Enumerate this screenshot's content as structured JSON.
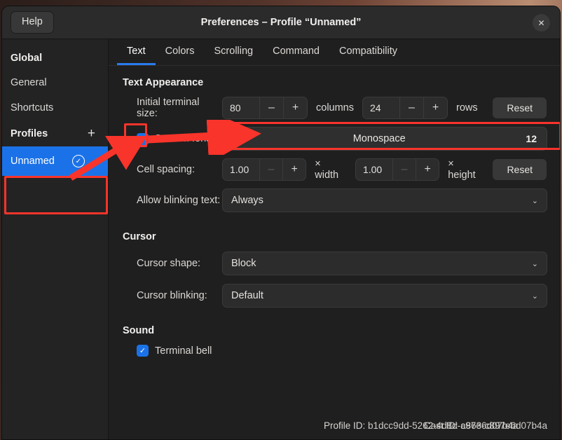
{
  "window": {
    "title": "Preferences – Profile “Unnamed”",
    "help_label": "Help",
    "close_icon": "close-icon",
    "close_glyph": "✕"
  },
  "sidebar": {
    "global_heading": "Global",
    "items": [
      {
        "label": "General"
      },
      {
        "label": "Shortcuts"
      }
    ],
    "profiles_heading": "Profiles",
    "add_glyph": "+",
    "profile": {
      "name": "Unnamed",
      "check_glyph": "✓",
      "chevron_glyph": "⌄"
    }
  },
  "tabs": [
    {
      "label": "Text",
      "active": true
    },
    {
      "label": "Colors",
      "active": false
    },
    {
      "label": "Scrolling",
      "active": false
    },
    {
      "label": "Command",
      "active": false
    },
    {
      "label": "Compatibility",
      "active": false
    }
  ],
  "text_appearance": {
    "heading": "Text Appearance",
    "terminal_size": {
      "label": "Initial terminal size:",
      "columns_value": "80",
      "columns_unit": "columns",
      "rows_value": "24",
      "rows_unit": "rows",
      "minus_glyph": "–",
      "plus_glyph": "+",
      "reset_label": "Reset"
    },
    "custom_font": {
      "label": "Custom font:",
      "checked": true,
      "check_glyph": "✓",
      "font_name": "Monospace",
      "font_size": "12"
    },
    "cell_spacing": {
      "label": "Cell spacing:",
      "width_value": "1.00",
      "width_unit": "× width",
      "height_value": "1.00",
      "height_unit": "× height",
      "minus_glyph": "–",
      "plus_glyph": "+",
      "reset_label": "Reset"
    },
    "blinking": {
      "label": "Allow blinking text:",
      "value": "Always",
      "chevron_glyph": "⌄"
    }
  },
  "cursor": {
    "heading": "Cursor",
    "shape": {
      "label": "Cursor shape:",
      "value": "Block",
      "chevron_glyph": "⌄"
    },
    "blinking": {
      "label": "Cursor blinking:",
      "value": "Default",
      "chevron_glyph": "⌄"
    }
  },
  "sound": {
    "heading": "Sound",
    "terminal_bell": {
      "label": "Terminal bell",
      "checked": true,
      "check_glyph": "✓"
    }
  },
  "footer": {
    "profile_id_label": "Profile ID:",
    "profile_id_value": "b1dcc9dd-5262-4d8d-a863-c897e6d07b4a",
    "profile_id_overlap": "Cast ID: c97e6d07b4a"
  },
  "annotations": {
    "accent_red": "#f8342b",
    "boxes": [
      {
        "name": "custom-font-checkbox-highlight"
      },
      {
        "name": "custom-font-field-highlight"
      },
      {
        "name": "profile-unnamed-highlight"
      }
    ],
    "arrows": [
      {
        "name": "arrow-to-custom-font-field"
      },
      {
        "name": "arrow-to-custom-font-checkbox"
      }
    ]
  },
  "colors": {
    "accent_blue": "#1b72e8",
    "tab_underline": "#2a7bee",
    "window_bg": "#1f1f1f",
    "header_bg": "#2b2b2b",
    "sidebar_bg": "#232323"
  }
}
